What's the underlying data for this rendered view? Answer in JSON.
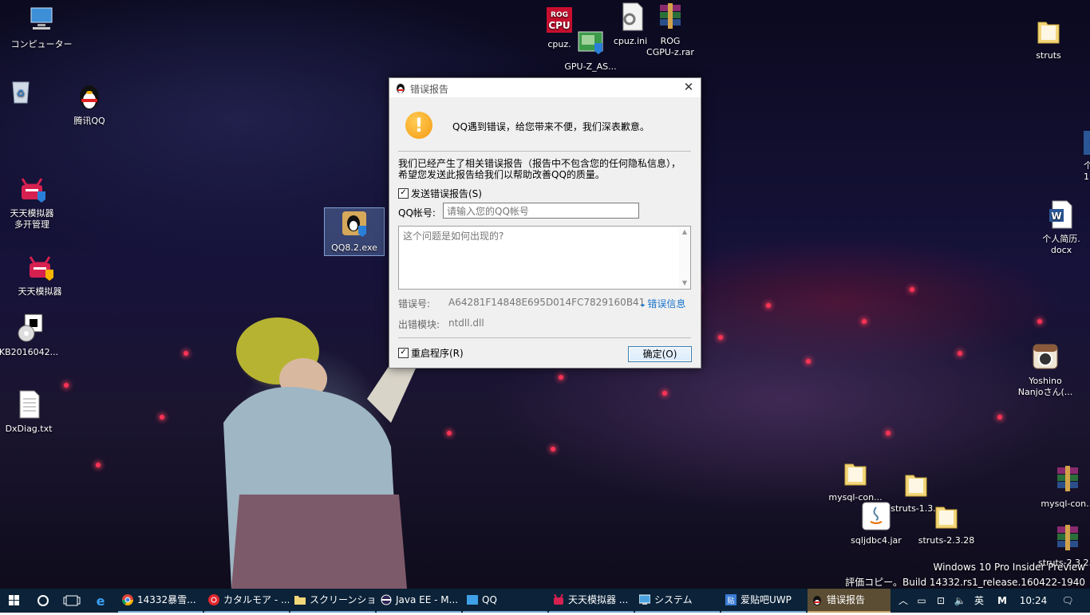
{
  "desktop": {
    "icons": [
      {
        "name": "computer",
        "label": "コンピューター"
      },
      {
        "name": "recycle-bin",
        "label": ""
      },
      {
        "name": "tencent-qq",
        "label": "腾讯QQ"
      },
      {
        "name": "tiantian-multi",
        "label": "天天模拟器\n多开管理"
      },
      {
        "name": "tiantian",
        "label": "天天模拟器"
      },
      {
        "name": "qq-exe",
        "label": "QQ8.2.exe"
      },
      {
        "name": "kb-file",
        "label": "KB2016042..."
      },
      {
        "name": "dxdiag",
        "label": "DxDiag.txt"
      },
      {
        "name": "cpuz",
        "label": "cpuz."
      },
      {
        "name": "gpuz",
        "label": "GPU-Z_AS..."
      },
      {
        "name": "cpuz-ini",
        "label": "cpuz.ini"
      },
      {
        "name": "rog-rar",
        "label": "ROG\nCGPU-z.rar"
      },
      {
        "name": "struts-top",
        "label": "struts"
      },
      {
        "name": "resume-partial",
        "label": "个\n1"
      },
      {
        "name": "resume",
        "label": "个人简历.\ndocx"
      },
      {
        "name": "yoshino",
        "label": "Yoshino\nNanjoさん(..."
      },
      {
        "name": "mysql-con-folder",
        "label": "mysql-con..."
      },
      {
        "name": "struts-1",
        "label": "struts-1.3..."
      },
      {
        "name": "mysql-con-rar",
        "label": "mysql-con..."
      },
      {
        "name": "sqljdbc",
        "label": "sqljdbc4.jar"
      },
      {
        "name": "struts-2",
        "label": "struts-2.3.28"
      },
      {
        "name": "struts-2-rar",
        "label": "struts-2.3.2..."
      }
    ],
    "watermark": {
      "line1": "Windows 10 Pro Insider Preview",
      "line2": "評価コピー。Build 14332.rs1_release.160422-1940"
    }
  },
  "dialog": {
    "title": "错误报告",
    "headline": "QQ遇到错误，给您带来不便，我们深表歉意。",
    "desc_line1": "我们已经产生了相关错误报告（报告中不包含您的任何隐私信息），",
    "desc_line2": "希望您发送此报告给我们以帮助改善QQ的质量。",
    "send_report_label": "发送错误报告(S)",
    "send_report_checked": true,
    "qq_label": "QQ帐号:",
    "qq_placeholder": "请输入您的QQ帐号",
    "textarea_placeholder": "这个问题是如何出现的?",
    "error_no_label": "错误号:",
    "error_no": "A64281F14848E695D014FC7829160B41",
    "error_info_link": "错误信息",
    "module_label": "出错模块:",
    "module": "ntdll.dll",
    "restart_label": "重启程序(R)",
    "restart_checked": true,
    "ok_label": "确定(O)"
  },
  "taskbar": {
    "tasks": [
      {
        "label": "14332暴雪..."
      },
      {
        "label": "カタルモア - ..."
      },
      {
        "label": "スクリーンショ..."
      },
      {
        "label": "Java EE - M..."
      },
      {
        "label": "QQ"
      },
      {
        "label": "天天模拟器 ..."
      },
      {
        "label": "システム"
      },
      {
        "label": "爱贴吧UWP"
      },
      {
        "label": "错误报告"
      }
    ],
    "ime": "英",
    "ime2": "M",
    "clock": "10:24"
  },
  "colors": {
    "taskbar": "#0b2238",
    "accent": "#1874cd",
    "warning": "#f59a11"
  }
}
